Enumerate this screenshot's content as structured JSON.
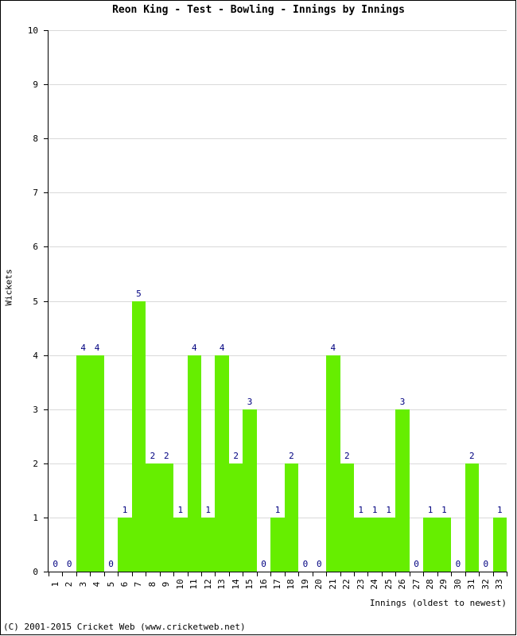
{
  "chart_data": {
    "type": "bar",
    "title": "Reon King - Test - Bowling - Innings by Innings",
    "xlabel": "Innings (oldest to newest)",
    "ylabel": "Wickets",
    "categories": [
      "1",
      "2",
      "3",
      "4",
      "5",
      "6",
      "7",
      "8",
      "9",
      "10",
      "11",
      "12",
      "13",
      "14",
      "15",
      "16",
      "17",
      "18",
      "19",
      "20",
      "21",
      "22",
      "23",
      "24",
      "25",
      "26",
      "27",
      "28",
      "29",
      "30",
      "31",
      "32",
      "33"
    ],
    "values": [
      0,
      0,
      4,
      4,
      0,
      1,
      5,
      2,
      2,
      1,
      4,
      1,
      4,
      2,
      3,
      0,
      1,
      2,
      0,
      0,
      4,
      2,
      1,
      1,
      1,
      3,
      0,
      1,
      1,
      0,
      2,
      0,
      1
    ],
    "data_labels": [
      "0",
      "0",
      "4",
      "4",
      "0",
      "1",
      "5",
      "2",
      "2",
      "1",
      "4",
      "1",
      "4",
      "2",
      "3",
      "0",
      "1",
      "2",
      "0",
      "0",
      "4",
      "2",
      "1",
      "1",
      "1",
      "3",
      "0",
      "1",
      "1",
      "0",
      "2",
      "0",
      "1"
    ],
    "ylim": [
      0,
      10
    ],
    "yticks": [
      "0",
      "1",
      "2",
      "3",
      "4",
      "5",
      "6",
      "7",
      "8",
      "9",
      "10"
    ],
    "grid": true,
    "legend": null,
    "bar_color": "#66ee00",
    "label_color": "#000080",
    "grid_color": "#d9d9d9",
    "axis_color": "#000000"
  },
  "footer": {
    "copyright": "(C) 2001-2015 Cricket Web (www.cricketweb.net)"
  }
}
